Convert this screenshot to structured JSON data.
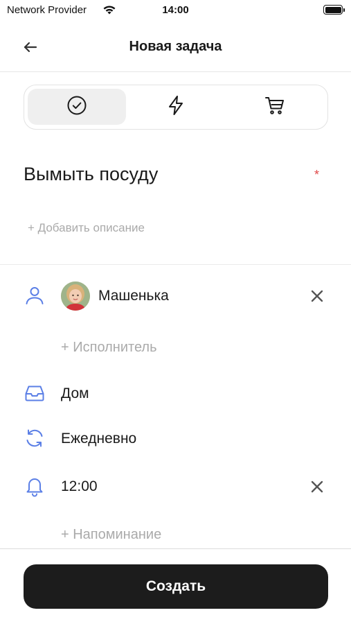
{
  "status_bar": {
    "carrier": "Network Provider",
    "time": "14:00"
  },
  "header": {
    "title": "Новая задача",
    "back_icon": "arrow-left-icon"
  },
  "task_types": [
    {
      "icon": "check-circle-icon",
      "selected": true
    },
    {
      "icon": "lightning-icon",
      "selected": false
    },
    {
      "icon": "shopping-cart-icon",
      "selected": false
    }
  ],
  "task": {
    "title": "Вымыть посуду",
    "required_mark": "*",
    "add_description": "+ Добавить описание"
  },
  "assignee": {
    "icon": "user-icon",
    "name": "Машенька",
    "add_label": "+ Исполнитель"
  },
  "category": {
    "icon": "inbox-icon",
    "label": "Дом"
  },
  "repeat": {
    "icon": "refresh-icon",
    "label": "Ежедневно"
  },
  "reminder": {
    "icon": "bell-icon",
    "time": "12:00",
    "add_label": "+ Напоминание"
  },
  "actions": {
    "create_label": "Создать"
  },
  "colors": {
    "accent": "#5b7fe6",
    "button_bg": "#1c1c1c",
    "required": "#e04848",
    "placeholder": "#aaaaaa"
  }
}
